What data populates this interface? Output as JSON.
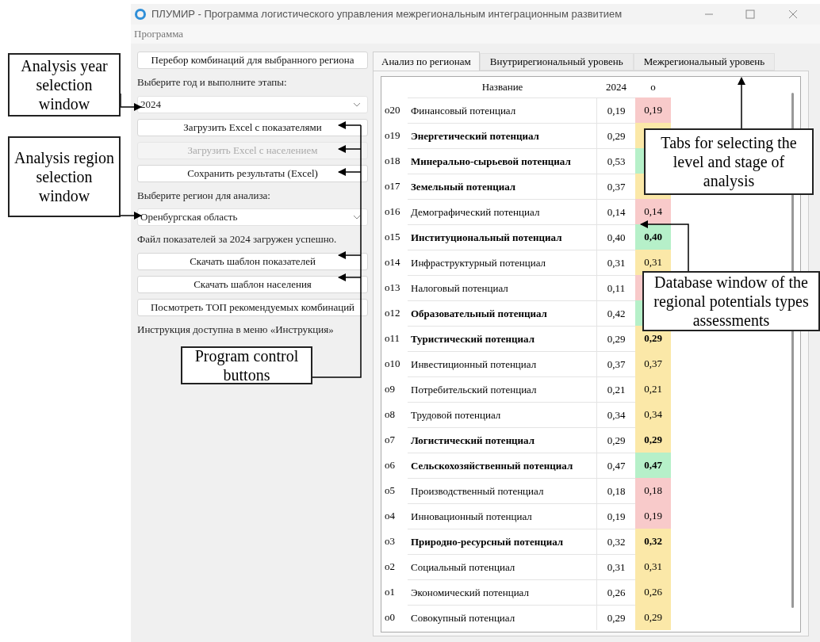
{
  "window": {
    "title": "ПЛУМИР - Программа логистического управления межрегиональным интеграционным развитием"
  },
  "menu": [
    "Программа"
  ],
  "left_panel": {
    "items": [
      {
        "kind": "button",
        "label": "Перебор комбинаций для выбранного региона",
        "disabled": false
      },
      {
        "kind": "label",
        "text": "Выберите год и выполните этапы:"
      },
      {
        "kind": "select",
        "value": "2024"
      },
      {
        "kind": "button",
        "label": "Загрузить Excel с показателями",
        "disabled": false
      },
      {
        "kind": "button",
        "label": "Загрузить Excel с населением",
        "disabled": true
      },
      {
        "kind": "button",
        "label": "Сохранить результаты (Excel)",
        "disabled": false
      },
      {
        "kind": "label",
        "text": "Выберите регион для анализа:"
      },
      {
        "kind": "select",
        "value": "Оренбургская область"
      },
      {
        "kind": "label",
        "text": "Файл показателей за 2024 загружен успешно."
      },
      {
        "kind": "button",
        "label": "Скачать шаблон показателей",
        "disabled": false
      },
      {
        "kind": "button",
        "label": "Скачать шаблон населения",
        "disabled": false
      },
      {
        "kind": "button",
        "label": "Посмотреть ТОП рекомендуемых комбинаций",
        "disabled": false
      },
      {
        "kind": "label",
        "text": "Инструкция доступна в меню «Инструкция»"
      }
    ]
  },
  "tabs": [
    {
      "label": "Анализ по регионам",
      "selected": true
    },
    {
      "label": "Внутрирегиональный уровень",
      "selected": false
    },
    {
      "label": "Межрегиональный уровень",
      "selected": false
    }
  ],
  "table": {
    "columns": [
      "Название",
      "2024",
      "о"
    ],
    "rows": [
      {
        "index": "о20",
        "name": "Финансовый потенциал",
        "value": "0,19",
        "score": "0,19",
        "bold": false,
        "color": "#f8caca"
      },
      {
        "index": "о19",
        "name": "Энергетический потенциал",
        "value": "0,29",
        "bold": true,
        "color": "#fbe8a8"
      },
      {
        "index": "о18",
        "name": "Минерально-сырьевой потенциал",
        "value": "0,53",
        "bold": true,
        "color": "#b6f0c9"
      },
      {
        "index": "о17",
        "name": "Земельный потенциал",
        "value": "0,37",
        "bold": true,
        "color": "#fbe8a8"
      },
      {
        "index": "о16",
        "name": "Демографический потенциал",
        "value": "0,14",
        "score": "0,14",
        "bold": false,
        "color": "#f8caca"
      },
      {
        "index": "о15",
        "name": "Институциональный потенциал",
        "value": "0,40",
        "score": "0,40",
        "bold": true,
        "color": "#b6f0c9"
      },
      {
        "index": "о14",
        "name": "Инфраструктурный потенциал",
        "value": "0,31",
        "score": "0,31",
        "bold": false,
        "color": "#fbe8a8"
      },
      {
        "index": "о13",
        "name": "Налоговый потенциал",
        "value": "0,11",
        "bold": false,
        "color": "#f8caca"
      },
      {
        "index": "о12",
        "name": "Образовательный потенциал",
        "value": "0,42",
        "bold": true,
        "color": "#b6f0c9"
      },
      {
        "index": "о11",
        "name": "Туристический потенциал",
        "value": "0,29",
        "score": "0,29",
        "bold": true,
        "color": "#fbe8a8"
      },
      {
        "index": "о10",
        "name": "Инвестиционный потенциал",
        "value": "0,37",
        "score": "0,37",
        "bold": false,
        "color": "#fbe8a8"
      },
      {
        "index": "о9",
        "name": "Потребительский потенциал",
        "value": "0,21",
        "score": "0,21",
        "bold": false,
        "color": "#fbe8a8"
      },
      {
        "index": "о8",
        "name": "Трудовой потенциал",
        "value": "0,34",
        "score": "0,34",
        "bold": false,
        "color": "#fbe8a8"
      },
      {
        "index": "о7",
        "name": "Логистический потенциал",
        "value": "0,29",
        "score": "0,29",
        "bold": true,
        "color": "#fbe8a8"
      },
      {
        "index": "о6",
        "name": "Сельскохозяйственный потенциал",
        "value": "0,47",
        "score": "0,47",
        "bold": true,
        "color": "#b6f0c9"
      },
      {
        "index": "о5",
        "name": "Производственный потенциал",
        "value": "0,18",
        "score": "0,18",
        "bold": false,
        "color": "#f8caca"
      },
      {
        "index": "о4",
        "name": "Инновационный потенциал",
        "value": "0,19",
        "score": "0,19",
        "bold": false,
        "color": "#f8caca"
      },
      {
        "index": "о3",
        "name": "Природно-ресурсный потенциал",
        "value": "0,32",
        "score": "0,32",
        "bold": true,
        "color": "#fbe8a8"
      },
      {
        "index": "о2",
        "name": "Социальный потенциал",
        "value": "0,31",
        "score": "0,31",
        "bold": false,
        "color": "#fbe8a8"
      },
      {
        "index": "о1",
        "name": "Экономический потенциал",
        "value": "0,26",
        "score": "0,26",
        "bold": false,
        "color": "#fbe8a8"
      },
      {
        "index": "о0",
        "name": "Совокупный потенциал",
        "value": "0,29",
        "score": "0,29",
        "bold": false,
        "color": "#fbe8a8"
      }
    ]
  },
  "annotations": [
    {
      "text": "Analysis year selection window"
    },
    {
      "text": "Analysis region selection window"
    },
    {
      "text": "Program control buttons"
    },
    {
      "text": "Tabs for selecting the level and stage of analysis"
    },
    {
      "text": "Database window of the regional potentials types assessments"
    }
  ]
}
